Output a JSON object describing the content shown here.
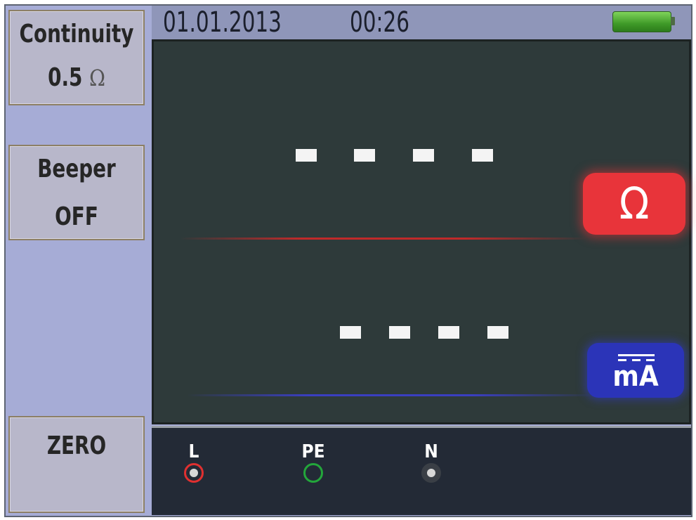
{
  "softkeys": {
    "continuity": {
      "label": "Continuity",
      "value": "0.5",
      "unit": "Ω"
    },
    "beeper": {
      "label": "Beeper",
      "value": "OFF"
    },
    "zero": {
      "label": "ZERO"
    }
  },
  "status": {
    "date": "01.01.2013",
    "time": "00:26",
    "battery_icon": "battery-full-icon"
  },
  "display": {
    "resistance_unit": "Ω",
    "current_unit": "mA",
    "current_unit_symbol": "dc-symbol-icon",
    "accent_colors": {
      "resistance": "#e8343a",
      "current": "#2b34b8"
    }
  },
  "terminals": {
    "items": [
      {
        "label": "L",
        "color": "#e03030"
      },
      {
        "label": "PE",
        "color": "#23a63b"
      },
      {
        "label": "N",
        "color": "#3a3f46"
      }
    ]
  }
}
